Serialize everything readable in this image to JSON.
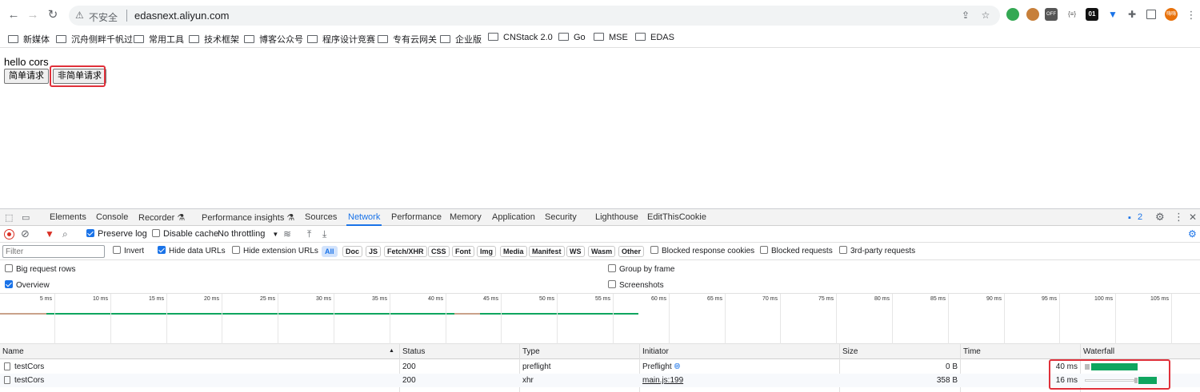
{
  "browser": {
    "security_label": "不安全",
    "url": "edasnext.aliyun.com",
    "extensions": [
      {
        "name": "green-extension-icon",
        "color": "#34a853"
      },
      {
        "name": "cookie-extension-icon",
        "color": "#c77f3a"
      },
      {
        "name": "off-extension-icon",
        "text": "OFF",
        "color": "#555"
      },
      {
        "name": "json-extension-icon",
        "text": "{≡}",
        "color": "#888"
      },
      {
        "name": "01-extension-icon",
        "text": "01",
        "color": "#111"
      },
      {
        "name": "filter-extension-icon",
        "color": "#1a73e8"
      },
      {
        "name": "puzzle-extension-icon",
        "color": "#5f6368"
      }
    ],
    "avatar_text": "嗨嗨"
  },
  "bookmarks": [
    "新媒体",
    "沉舟侧畔千帆过",
    "常用工具",
    "技术框架",
    "博客公众号",
    "程序设计竞赛",
    "专有云网关",
    "企业版",
    "CNStack 2.0",
    "Go",
    "MSE",
    "EDAS"
  ],
  "page": {
    "hello_text": "hello cors",
    "simple_button": "简单请求",
    "non_simple_button": "非简单请求"
  },
  "devtools": {
    "tabs": [
      "Elements",
      "Console",
      "Recorder",
      "Performance insights",
      "Sources",
      "Network",
      "Performance",
      "Memory",
      "Application",
      "Security",
      "Lighthouse",
      "EditThisCookie"
    ],
    "active_tab": "Network",
    "issues_count": "2",
    "toolbar": {
      "preserve_log": "Preserve log",
      "disable_cache": "Disable cache",
      "throttling": "No throttling"
    },
    "filter": {
      "placeholder": "Filter",
      "invert": "Invert",
      "hide_data_urls": "Hide data URLs",
      "hide_extension_urls": "Hide extension URLs",
      "types": [
        "All",
        "Doc",
        "JS",
        "Fetch/XHR",
        "CSS",
        "Font",
        "Img",
        "Media",
        "Manifest",
        "WS",
        "Wasm",
        "Other"
      ],
      "blocked_response_cookies": "Blocked response cookies",
      "blocked_requests": "Blocked requests",
      "third_party": "3rd-party requests"
    },
    "options": {
      "big_request_rows": "Big request rows",
      "group_by_frame": "Group by frame",
      "overview": "Overview",
      "screenshots": "Screenshots"
    },
    "timeline_ticks": [
      "5 ms",
      "10 ms",
      "15 ms",
      "20 ms",
      "25 ms",
      "30 ms",
      "35 ms",
      "40 ms",
      "45 ms",
      "50 ms",
      "55 ms",
      "60 ms",
      "65 ms",
      "70 ms",
      "75 ms",
      "80 ms",
      "85 ms",
      "90 ms",
      "95 ms",
      "100 ms",
      "105 ms"
    ],
    "columns": [
      "Name",
      "Status",
      "Type",
      "Initiator",
      "Size",
      "Time",
      "Waterfall"
    ],
    "requests": [
      {
        "name": "testCors",
        "status": "200",
        "type": "preflight",
        "initiator": "Preflight",
        "size": "0 B",
        "time": "40 ms"
      },
      {
        "name": "testCors",
        "status": "200",
        "type": "xhr",
        "initiator": "main.js:199",
        "size": "358 B",
        "time": "16 ms"
      }
    ]
  },
  "colors": {
    "accent": "#1a73e8",
    "highlight_box": "#e0303a",
    "waterfall_green": "#0fa55f"
  }
}
